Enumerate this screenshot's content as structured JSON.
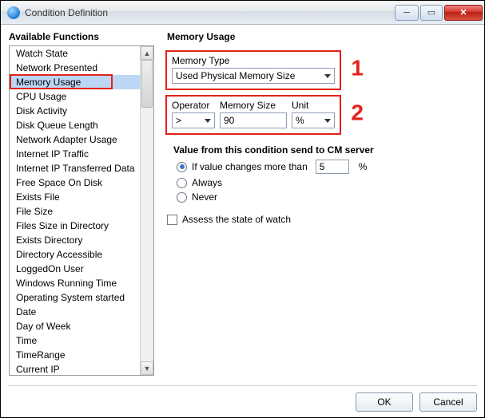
{
  "window": {
    "title": "Condition Definition"
  },
  "left": {
    "label": "Available Functions",
    "items": [
      "Watch State",
      "Network Presented",
      "Memory Usage",
      "CPU Usage",
      "Disk Activity",
      "Disk Queue Length",
      "Network Adapter Usage",
      "Internet IP Traffic",
      "Internet IP Transferred Data",
      "Free Space On Disk",
      "Exists File",
      "File Size",
      "Files Size in Directory",
      "Exists Directory",
      "Directory Accessible",
      "LoggedOn User",
      "Windows Running Time",
      "Operating System started",
      "Date",
      "Day of Week",
      "Time",
      "TimeRange",
      "Current IP"
    ],
    "selected_index": 2
  },
  "right": {
    "heading": "Memory Usage",
    "mem": {
      "type_label": "Memory Type",
      "type_value": "Used Physical Memory Size",
      "annot": "1"
    },
    "cond": {
      "operator_label": "Operator",
      "operator_value": ">",
      "size_label": "Memory Size",
      "size_value": "90",
      "unit_label": "Unit",
      "unit_value": "%",
      "annot": "2"
    },
    "group": {
      "title": "Value from this condition send to CM server",
      "opt_changes": "If value changes more than",
      "changes_value": "5",
      "changes_unit": "%",
      "opt_always": "Always",
      "opt_never": "Never"
    },
    "assess_label": "Assess the state of watch"
  },
  "buttons": {
    "ok": "OK",
    "cancel": "Cancel"
  }
}
